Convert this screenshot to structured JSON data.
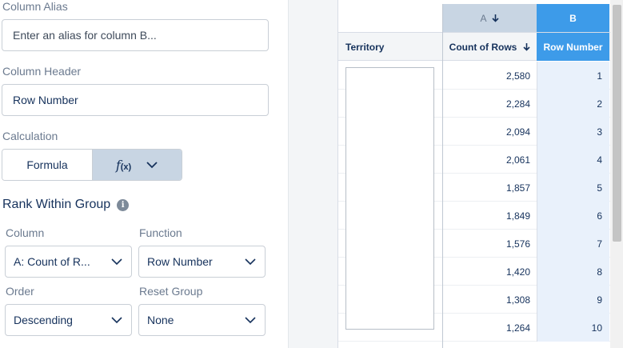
{
  "config": {
    "column_alias": {
      "label": "Column Alias",
      "placeholder": "Enter an alias for column B..."
    },
    "column_header": {
      "label": "Column Header",
      "value": "Row Number"
    },
    "calculation": {
      "label": "Calculation",
      "formula_label": "Formula",
      "fx_label": "f",
      "fx_sub": "(x)"
    },
    "rank_within_group": {
      "title": "Rank Within Group",
      "column": {
        "label": "Column",
        "value": "A: Count of R..."
      },
      "function": {
        "label": "Function",
        "value": "Row Number"
      },
      "order": {
        "label": "Order",
        "value": "Descending"
      },
      "reset_group": {
        "label": "Reset Group",
        "value": "None"
      }
    }
  },
  "grid": {
    "col_letters": {
      "a": "A",
      "b": "B"
    },
    "headers": {
      "territory": "Territory",
      "count": "Count of Rows",
      "row_number": "Row Number"
    },
    "rows": [
      {
        "count": "2,580",
        "row_number": "1"
      },
      {
        "count": "2,284",
        "row_number": "2"
      },
      {
        "count": "2,094",
        "row_number": "3"
      },
      {
        "count": "2,061",
        "row_number": "4"
      },
      {
        "count": "1,857",
        "row_number": "5"
      },
      {
        "count": "1,849",
        "row_number": "6"
      },
      {
        "count": "1,576",
        "row_number": "7"
      },
      {
        "count": "1,420",
        "row_number": "8"
      },
      {
        "count": "1,308",
        "row_number": "9"
      },
      {
        "count": "1,264",
        "row_number": "10"
      }
    ]
  },
  "colors": {
    "accent": "#3d9be9",
    "selected_col_bg": "#e9f1fb",
    "fx_bg": "#c8d5e3"
  },
  "icons": {
    "info": "info-icon",
    "sort_down": "arrow-down-icon",
    "dropdown": "chevron-down-icon"
  }
}
